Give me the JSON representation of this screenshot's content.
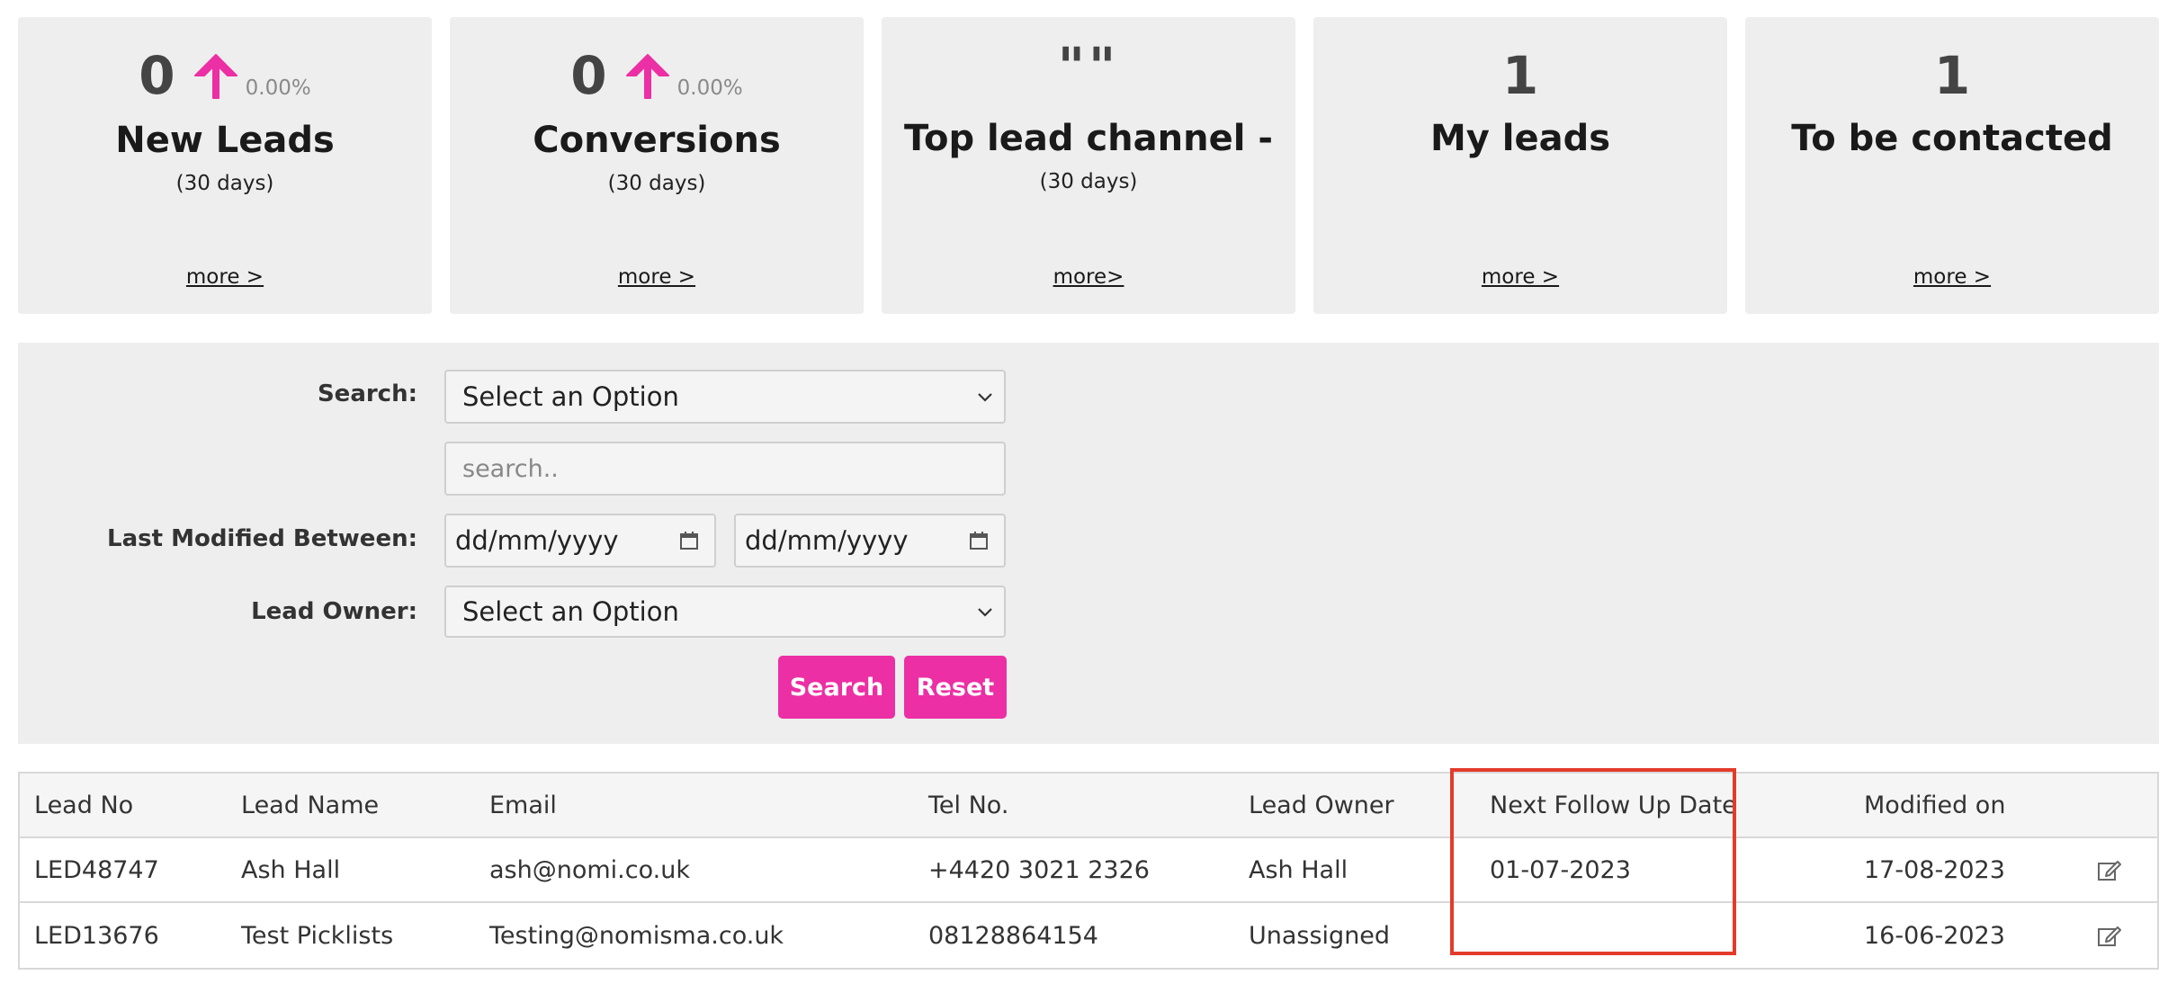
{
  "cards": [
    {
      "number": "0",
      "percent": "0.00%",
      "title": "New Leads",
      "subtitle": "(30 days)",
      "more": "more >"
    },
    {
      "number": "0",
      "percent": "0.00%",
      "title": "Conversions",
      "subtitle": "(30 days)",
      "more": "more >"
    },
    {
      "number": "\"\"",
      "title": "Top lead channel -",
      "subtitle": "(30 days)",
      "more": "more>"
    },
    {
      "number": "1",
      "title": "My leads",
      "more": "more >"
    },
    {
      "number": "1",
      "title": "To be contacted",
      "more": "more >"
    }
  ],
  "search_panel": {
    "search_label": "Search:",
    "search_select_value": "Select an Option",
    "search_input_placeholder": "search..",
    "last_modified_label": "Last Modified Between:",
    "date_from": "dd/mm/yyyy",
    "date_to": "dd/mm/yyyy",
    "lead_owner_label": "Lead Owner:",
    "lead_owner_value": "Select an Option",
    "search_button": "Search",
    "reset_button": "Reset"
  },
  "table": {
    "headers": [
      "Lead No",
      "Lead Name",
      "Email",
      "Tel No.",
      "Lead Owner",
      "Next Follow Up Date",
      "Modified on"
    ],
    "rows": [
      [
        "LED48747",
        "Ash Hall",
        "ash@nomi.co.uk",
        "+4420 3021 2326",
        "Ash Hall",
        "01-07-2023",
        "17-08-2023"
      ],
      [
        "LED13676",
        "Test Picklists",
        "Testing@nomisma.co.uk",
        "08128864154",
        "Unassigned",
        "",
        "16-06-2023"
      ]
    ]
  },
  "colors": {
    "accent": "#ec2fa4",
    "highlight": "#e33b2b",
    "card_bg": "#eeeeee"
  },
  "icons": [
    "arrow-up-icon",
    "chevron-down-icon",
    "calendar-icon",
    "edit-icon"
  ]
}
